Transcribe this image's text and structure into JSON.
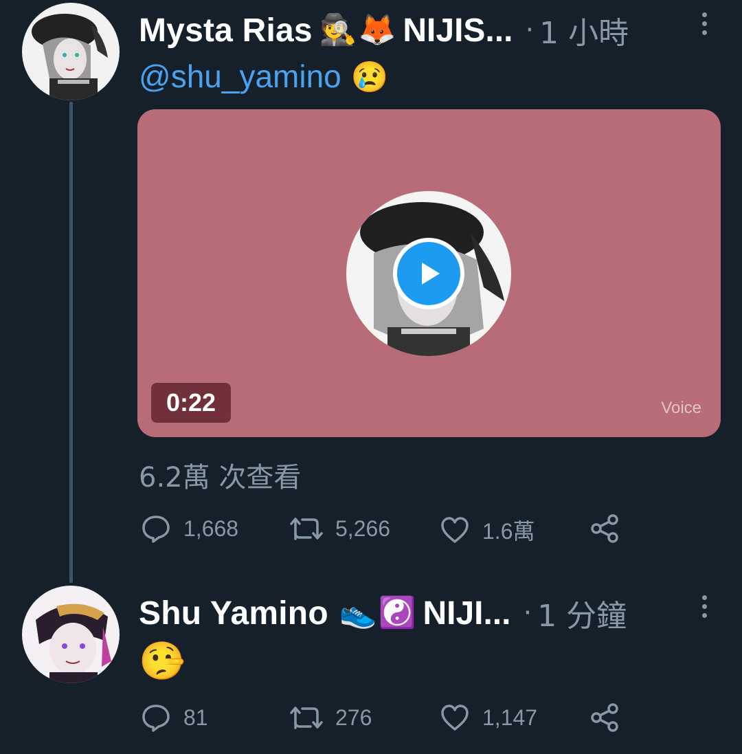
{
  "tweet1": {
    "display_name": "Mysta Rias",
    "name_emojis": [
      "🕵️",
      "🦊"
    ],
    "name_suffix": "NIJIS...",
    "dot": "·",
    "time": "1 小時",
    "mention": "@shu_yamino",
    "mention_emoji": "😢",
    "media": {
      "duration": "0:22",
      "watermark": "Voice",
      "bg_color": "#b86c77"
    },
    "views": "6.2萬 次查看",
    "actions": {
      "replies": "1,668",
      "retweets": "5,266",
      "likes": "1.6萬"
    }
  },
  "tweet2": {
    "display_name": "Shu Yamino",
    "name_emojis": [
      "👟",
      "☯️"
    ],
    "name_suffix": "NIJI...",
    "dot": "·",
    "time": "1 分鐘",
    "content_emoji": "🤥",
    "actions": {
      "replies": "81",
      "retweets": "276",
      "likes": "1,147"
    }
  },
  "colors": {
    "background": "#15202b",
    "secondary_text": "#8899a6",
    "link": "#4aa3ee",
    "accent": "#1d9bf0"
  }
}
